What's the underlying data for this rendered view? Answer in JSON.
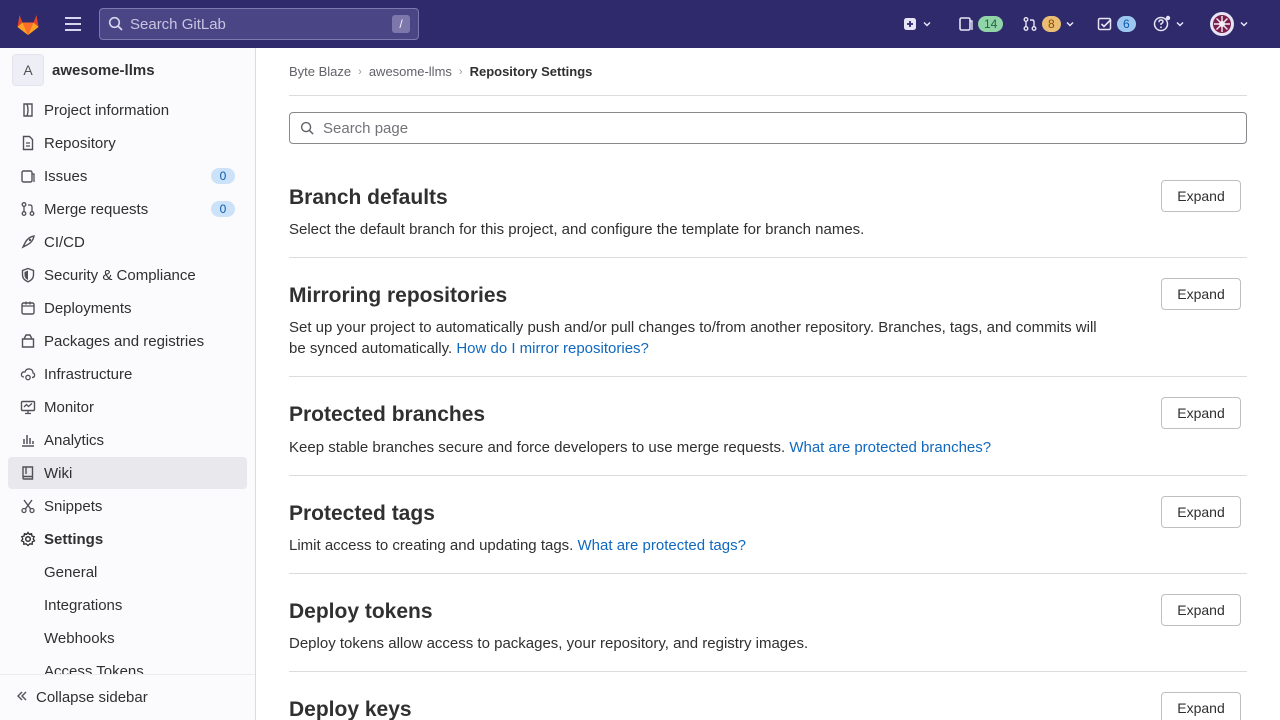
{
  "topbar": {
    "search_placeholder": "Search GitLab",
    "search_shortcut": "/",
    "issues_count": "14",
    "mr_count": "8",
    "todo_count": "6"
  },
  "sidebar": {
    "project_initial": "A",
    "project_name": "awesome-llms",
    "items": [
      {
        "label": "Project information",
        "icon": "info-icon"
      },
      {
        "label": "Repository",
        "icon": "document-icon"
      },
      {
        "label": "Issues",
        "icon": "issues-icon",
        "count": "0"
      },
      {
        "label": "Merge requests",
        "icon": "merge-request-icon",
        "count": "0"
      },
      {
        "label": "CI/CD",
        "icon": "rocket-icon"
      },
      {
        "label": "Security & Compliance",
        "icon": "shield-icon"
      },
      {
        "label": "Deployments",
        "icon": "deployments-icon"
      },
      {
        "label": "Packages and registries",
        "icon": "package-icon"
      },
      {
        "label": "Infrastructure",
        "icon": "cloud-gear-icon"
      },
      {
        "label": "Monitor",
        "icon": "monitor-icon"
      },
      {
        "label": "Analytics",
        "icon": "chart-icon"
      },
      {
        "label": "Wiki",
        "icon": "book-icon"
      },
      {
        "label": "Snippets",
        "icon": "scissors-icon"
      },
      {
        "label": "Settings",
        "icon": "gear-icon"
      }
    ],
    "settings_sub": [
      "General",
      "Integrations",
      "Webhooks",
      "Access Tokens"
    ],
    "collapse_label": "Collapse sidebar"
  },
  "breadcrumb": [
    "Byte Blaze",
    "awesome-llms",
    "Repository Settings"
  ],
  "page_search_placeholder": "Search page",
  "expand_label": "Expand",
  "sections": [
    {
      "title": "Branch defaults",
      "desc": "Select the default branch for this project, and configure the template for branch names.",
      "link": ""
    },
    {
      "title": "Mirroring repositories",
      "desc": "Set up your project to automatically push and/or pull changes to/from another repository. Branches, tags, and commits will be synced automatically.",
      "link": "How do I mirror repositories?"
    },
    {
      "title": "Protected branches",
      "desc": "Keep stable branches secure and force developers to use merge requests.",
      "link": "What are protected branches?"
    },
    {
      "title": "Protected tags",
      "desc": "Limit access to creating and updating tags.",
      "link": "What are protected tags?"
    },
    {
      "title": "Deploy tokens",
      "desc": "Deploy tokens allow access to packages, your repository, and registry images.",
      "link": ""
    },
    {
      "title": "Deploy keys",
      "desc": "",
      "link": ""
    }
  ],
  "colors": {
    "topbar": "#2f2a6b",
    "link": "#1068bf",
    "sidebar_bg": "#fbfafd"
  }
}
